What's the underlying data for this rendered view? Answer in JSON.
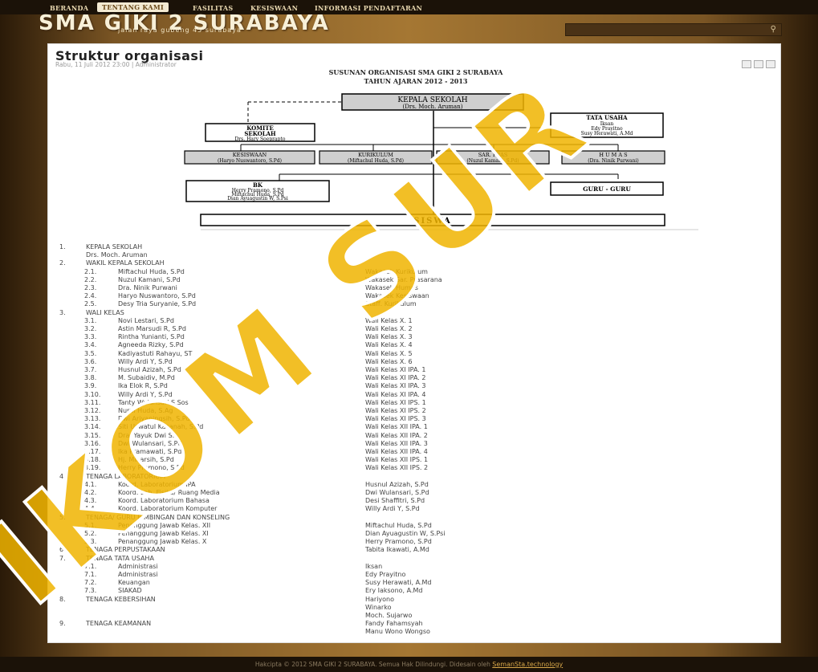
{
  "nav": [
    {
      "label": "BERANDA",
      "active": false
    },
    {
      "label": "TENTANG KAMI",
      "active": true
    },
    {
      "label": "FASILITAS",
      "active": false
    },
    {
      "label": "KESISWAAN",
      "active": false
    },
    {
      "label": "INFORMASI PENDAFTARAN",
      "active": false
    }
  ],
  "header": {
    "title": "SMA GIKI 2 SURABAYA",
    "subtitle": "jalan raya gubeng 45 surabaya"
  },
  "article": {
    "title": "Struktur organisasi",
    "meta": "Rabu, 11 Juli 2012 23:00 | Administrator",
    "chart_title_1": "SUSUNAN ORGANISASI SMA GIKI 2 SURABAYA",
    "chart_title_2": "TAHUN AJARAN 2012 - 2013"
  },
  "org": {
    "kepala": {
      "title": "KEPALA SEKOLAH",
      "name": "(Drs. Moch. Aruman)"
    },
    "komite": {
      "title1": "KOMITE",
      "title2": "SEKOLAH",
      "name": "Drs. Hary Soeprapto"
    },
    "tata_usaha": {
      "title": "TATA USAHA",
      "names": [
        "Iksan",
        "Edy Prayitno",
        "Susy Herawati, A.Md"
      ]
    },
    "wakil": [
      {
        "title": "KESISWAAN",
        "name": "(Haryo Nuswantoro, S.Pd)"
      },
      {
        "title": "KURIKULUM",
        "name": "(Miftachul Huda, S.Pd)"
      },
      {
        "title": "SAR. PRAS",
        "name": "(Nuzul Kamani, S.Pd)"
      },
      {
        "title": "H U M A S",
        "name": "(Dra. Ninik Purwani)"
      }
    ],
    "bk": {
      "title": "BK",
      "names": [
        "Herry Pramono, S.Pd",
        "Miftachul Huda, S.Pd",
        "Dian Ayuagustin W, S.Psi"
      ]
    },
    "guru": "GURU - GURU",
    "siswa": "SISWA"
  },
  "rows": [
    {
      "num": "1.",
      "label": "KEPALA SEKOLAH",
      "value": ""
    },
    {
      "num": "",
      "label": "Drs. Moch. Aruman",
      "value": ""
    },
    {
      "num": "2.",
      "label": "WAKIL KEPALA SEKOLAH",
      "value": ""
    },
    {
      "num": "2.1.",
      "label": "Miftachul Huda, S.Pd",
      "value": "Wakasek Kurikulum"
    },
    {
      "num": "2.2.",
      "label": "Nuzul Kamani, S.Pd",
      "value": "Wakasek Sar. Prasarana"
    },
    {
      "num": "2.3.",
      "label": "Dra. Ninik Purwani",
      "value": "Wakasek Humas"
    },
    {
      "num": "2.4.",
      "label": "Haryo Nuswantoro, S.Pd",
      "value": "Wakasek Kesiswaan"
    },
    {
      "num": "2.5.",
      "label": "Desy Tria Suryanie, S.Pd",
      "value": "Staff. Kurikulum"
    },
    {
      "num": "3.",
      "label": "WALI KELAS",
      "value": ""
    },
    {
      "num": "3.1.",
      "label": "Novi Lestari, S.Pd",
      "value": "Wali Kelas X. 1"
    },
    {
      "num": "3.2.",
      "label": "Astin Marsudi R, S.Pd",
      "value": "Wali Kelas X. 2"
    },
    {
      "num": "3.3.",
      "label": "Rintha Yunianti, S.Pd",
      "value": "Wali Kelas X. 3"
    },
    {
      "num": "3.4.",
      "label": "Agneeda Rizky, S.Pd",
      "value": "Wali Kelas X. 4"
    },
    {
      "num": "3.5.",
      "label": "Kadiyastuti Rahayu, ST",
      "value": "Wali Kelas X. 5"
    },
    {
      "num": "3.6.",
      "label": "Willy Ardi Y, S.Pd",
      "value": "Wali Kelas X. 6"
    },
    {
      "num": "3.7.",
      "label": "Husnul Azizah, S.Pd",
      "value": "Wali Kelas XI IPA. 1"
    },
    {
      "num": "3.8.",
      "label": "M. Subaidiv, M.Pd",
      "value": "Wali Kelas XI IPA. 2"
    },
    {
      "num": "3.9.",
      "label": "Ika Elok R, S.Pd",
      "value": "Wali Kelas XI IPA. 3"
    },
    {
      "num": "3.10.",
      "label": "Willy Ardi Y, S.Pd",
      "value": "Wali Kelas XI IPA. 4"
    },
    {
      "num": "3.11.",
      "label": "Tanty Wulansari S.Sos",
      "value": "Wali Kelas XI IPS. 1"
    },
    {
      "num": "3.12.",
      "label": "Nurul Huda, S.Ag",
      "value": "Wali Kelas XI IPS. 2"
    },
    {
      "num": "3.13.",
      "label": "Dwi Ariyaningsih, S.Pd",
      "value": "Wali Kelas XI IPS. 3"
    },
    {
      "num": "3.14.",
      "label": "Siti Uswatul Kasanah, S.Pd",
      "value": "Wali Kelas XII IPA. 1"
    },
    {
      "num": "3.15.",
      "label": "Dra. Yayuk Dwi S.",
      "value": "Wali Kelas XII IPA. 2"
    },
    {
      "num": "3.16.",
      "label": "Dwi Wulansari, S.Pd",
      "value": "Wali Kelas XII IPA. 3"
    },
    {
      "num": "3.17.",
      "label": "Ika Pramawati, S.Pd",
      "value": "Wali Kelas XII IPA. 4"
    },
    {
      "num": "3.18.",
      "label": "Hj. Minarsih, S.Pd",
      "value": "Wali Kelas XII IPS. 1"
    },
    {
      "num": "3.19.",
      "label": "Herry Pramono, S.Pd",
      "value": "Wali Kelas XII IPS. 2"
    },
    {
      "num": "4.",
      "label": "TENAGA LABORATORIUM",
      "value": ""
    },
    {
      "num": "4.1.",
      "label": "Koord. Laboratorium IPA",
      "value": "Husnul Azizah, S.Pd"
    },
    {
      "num": "4.2.",
      "label": "Koord. Lab. Fisika/ Ruang Media",
      "value": "Dwi Wulansari, S.Pd"
    },
    {
      "num": "4.3.",
      "label": "Koord. Laboratorium Bahasa",
      "value": "Desi Shaffitri, S.Pd"
    },
    {
      "num": "4.4.",
      "label": "Koord. Laboratorium Komputer",
      "value": "Willy Ardi Y, S.Pd"
    },
    {
      "num": "5.",
      "label": "TENAGA/ GURU BIMBINGAN DAN KONSELING",
      "value": ""
    },
    {
      "num": "5.1.",
      "label": "Penanggung Jawab Kelas. XII",
      "value": "Miftachul Huda, S.Pd"
    },
    {
      "num": "5.2.",
      "label": "Penanggung Jawab Kelas. XI",
      "value": "Dian Ayuagustin W, S.Psi"
    },
    {
      "num": "5.3.",
      "label": "Penanggung Jawab Kelas. X",
      "value": "Herry Pramono, S.Pd"
    },
    {
      "num": "6.",
      "label": "TENAGA PERPUSTAKAAN",
      "value": "Tabita Ikawati, A.Md"
    },
    {
      "num": "7.",
      "label": "TENAGA TATA USAHA",
      "value": ""
    },
    {
      "num": "7.1.",
      "label": "Administrasi",
      "value": "Iksan"
    },
    {
      "num": "7.1.",
      "label": "Administrasi",
      "value": "Edy Prayitno"
    },
    {
      "num": "7.2.",
      "label": "Keuangan",
      "value": "Susy Herawati, A.Md"
    },
    {
      "num": "7.3.",
      "label": "SIAKAD",
      "value": "Ery Iaksono, A.Md"
    },
    {
      "num": "8.",
      "label": "TENAGA KEBERSIHAN",
      "value": "Hariyono"
    },
    {
      "num": "",
      "label": "",
      "value": "Winarko"
    },
    {
      "num": "",
      "label": "",
      "value": "Moch. Sujarwo"
    },
    {
      "num": "9.",
      "label": "TENAGA KEAMANAN",
      "value": "Fandy Fahamsyah"
    },
    {
      "num": "",
      "label": "",
      "value": "Manu Wono Wongso"
    }
  ],
  "footer": {
    "text": "Hakcipta © 2012 SMA GIKI 2 SURABAYA. Semua Hak Dilindungi. Didesain oleh ",
    "link": "SemanSta.technology"
  },
  "watermark": "IKOM SUR",
  "colors": {
    "accent": "#f0b400",
    "link": "#d9a84a"
  }
}
